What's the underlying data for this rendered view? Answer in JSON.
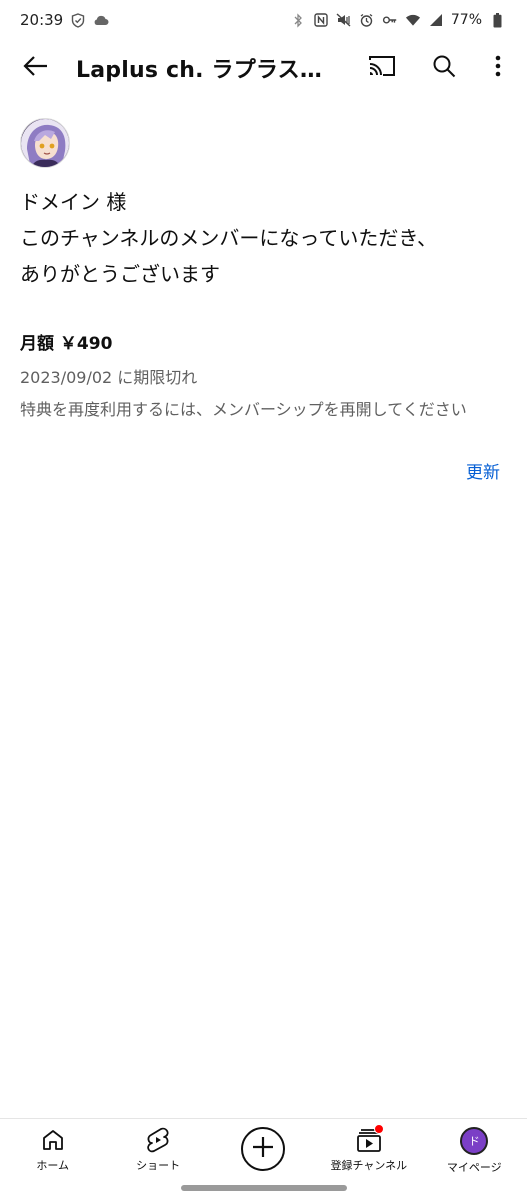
{
  "status_bar": {
    "time": "20:39",
    "battery": "77%"
  },
  "app_bar": {
    "title": "Laplus ch. ラプラス…"
  },
  "membership": {
    "greeting": "ドメイン 様",
    "thanks_line1": "このチャンネルのメンバーになっていただき、",
    "thanks_line2": "ありがとうございます",
    "price": "月額 ￥490",
    "expired": "2023/09/02 に期限切れ",
    "benefit": "特典を再度利用するには、メンバーシップを再開してください",
    "renew_label": "更新"
  },
  "bottom_nav": {
    "home_label": "ホーム",
    "shorts_label": "ショート",
    "subscriptions_label": "登録チャンネル",
    "mypage_label": "マイページ",
    "mypage_avatar_letter": "ド"
  },
  "colors": {
    "link": "#065fd4",
    "secondary_text": "#606060",
    "notification_dot": "#ff0000",
    "avatar_bg": "#7b3fc6"
  }
}
